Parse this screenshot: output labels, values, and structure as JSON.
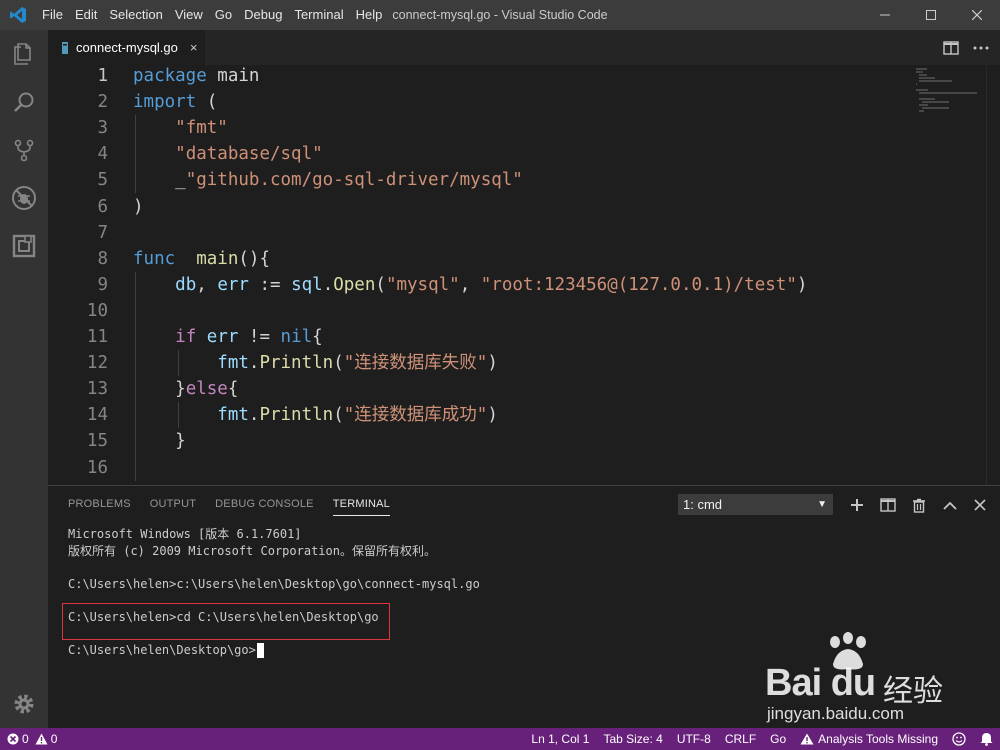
{
  "window": {
    "title": "connect-mysql.go - Visual Studio Code",
    "menu": [
      "File",
      "Edit",
      "Selection",
      "View",
      "Go",
      "Debug",
      "Terminal",
      "Help"
    ]
  },
  "activity_bar": {
    "icons": [
      "explorer-icon",
      "search-icon",
      "source-control-icon",
      "debug-icon",
      "extensions-icon",
      "settings-gear-icon"
    ]
  },
  "tab": {
    "label": "connect-mysql.go",
    "close_symbol": "×"
  },
  "editor": {
    "line_numbers": [
      "1",
      "2",
      "3",
      "4",
      "5",
      "6",
      "7",
      "8",
      "9",
      "10",
      "11",
      "12",
      "13",
      "14",
      "15",
      "16"
    ],
    "lines": [
      [
        {
          "t": "package",
          "c": "kw"
        },
        {
          "t": " main",
          "c": "plain"
        }
      ],
      [
        {
          "t": "import",
          "c": "kw"
        },
        {
          "t": " (",
          "c": "plain"
        }
      ],
      [
        {
          "t": "    ",
          "c": "plain"
        },
        {
          "t": "\"fmt\"",
          "c": "str"
        }
      ],
      [
        {
          "t": "    ",
          "c": "plain"
        },
        {
          "t": "\"database/sql\"",
          "c": "str"
        }
      ],
      [
        {
          "t": "    _",
          "c": "plain"
        },
        {
          "t": "\"github.com/go-sql-driver/mysql\"",
          "c": "str"
        }
      ],
      [
        {
          "t": ")",
          "c": "plain"
        }
      ],
      [],
      [
        {
          "t": "func",
          "c": "kw"
        },
        {
          "t": "  ",
          "c": "plain"
        },
        {
          "t": "main",
          "c": "fn"
        },
        {
          "t": "(){",
          "c": "plain"
        }
      ],
      [
        {
          "t": "    ",
          "c": "plain"
        },
        {
          "t": "db",
          "c": "var"
        },
        {
          "t": ", ",
          "c": "plain"
        },
        {
          "t": "err",
          "c": "var"
        },
        {
          "t": " := ",
          "c": "plain"
        },
        {
          "t": "sql",
          "c": "var"
        },
        {
          "t": ".",
          "c": "plain"
        },
        {
          "t": "Open",
          "c": "fn"
        },
        {
          "t": "(",
          "c": "plain"
        },
        {
          "t": "\"mysql\"",
          "c": "str"
        },
        {
          "t": ", ",
          "c": "plain"
        },
        {
          "t": "\"root:123456@(127.0.0.1)/test\"",
          "c": "str"
        },
        {
          "t": ")",
          "c": "plain"
        }
      ],
      [],
      [
        {
          "t": "    ",
          "c": "plain"
        },
        {
          "t": "if",
          "c": "kw2"
        },
        {
          "t": " ",
          "c": "plain"
        },
        {
          "t": "err",
          "c": "var"
        },
        {
          "t": " != ",
          "c": "plain"
        },
        {
          "t": "nil",
          "c": "kw"
        },
        {
          "t": "{",
          "c": "plain"
        }
      ],
      [
        {
          "t": "        ",
          "c": "plain"
        },
        {
          "t": "fmt",
          "c": "var"
        },
        {
          "t": ".",
          "c": "plain"
        },
        {
          "t": "Println",
          "c": "fn"
        },
        {
          "t": "(",
          "c": "plain"
        },
        {
          "t": "\"连接数据库失败\"",
          "c": "str"
        },
        {
          "t": ")",
          "c": "plain"
        }
      ],
      [
        {
          "t": "    }",
          "c": "plain"
        },
        {
          "t": "else",
          "c": "kw2"
        },
        {
          "t": "{",
          "c": "plain"
        }
      ],
      [
        {
          "t": "        ",
          "c": "plain"
        },
        {
          "t": "fmt",
          "c": "var"
        },
        {
          "t": ".",
          "c": "plain"
        },
        {
          "t": "Println",
          "c": "fn"
        },
        {
          "t": "(",
          "c": "plain"
        },
        {
          "t": "\"连接数据库成功\"",
          "c": "str"
        },
        {
          "t": ")",
          "c": "plain"
        }
      ],
      [
        {
          "t": "    }",
          "c": "plain"
        }
      ],
      []
    ]
  },
  "panel": {
    "tabs": [
      "PROBLEMS",
      "OUTPUT",
      "DEBUG CONSOLE",
      "TERMINAL"
    ],
    "active_tab": "TERMINAL",
    "terminal_select": "1: cmd",
    "terminal_lines": [
      "Microsoft Windows [版本 6.1.7601]",
      "版权所有 (c) 2009 Microsoft Corporation。保留所有权利。",
      "",
      "C:\\Users\\helen>c:\\Users\\helen\\Desktop\\go\\connect-mysql.go",
      "",
      "C:\\Users\\helen>cd C:\\Users\\helen\\Desktop\\go",
      "",
      "C:\\Users\\helen\\Desktop\\go>"
    ]
  },
  "status": {
    "errors": "0",
    "warnings": "0",
    "position": "Ln 1, Col 1",
    "tab_size": "Tab Size: 4",
    "encoding": "UTF-8",
    "eol": "CRLF",
    "language": "Go",
    "analysis": "Analysis Tools Missing"
  },
  "watermark": {
    "logo": "Bai du",
    "cn": "经验",
    "url": "jingyan.baidu.com"
  },
  "colors": {
    "statusbar": "#68217a",
    "titlebar": "#3c3c3c",
    "editor_bg": "#1e1e1e",
    "highlight_box": "#d9363e"
  }
}
